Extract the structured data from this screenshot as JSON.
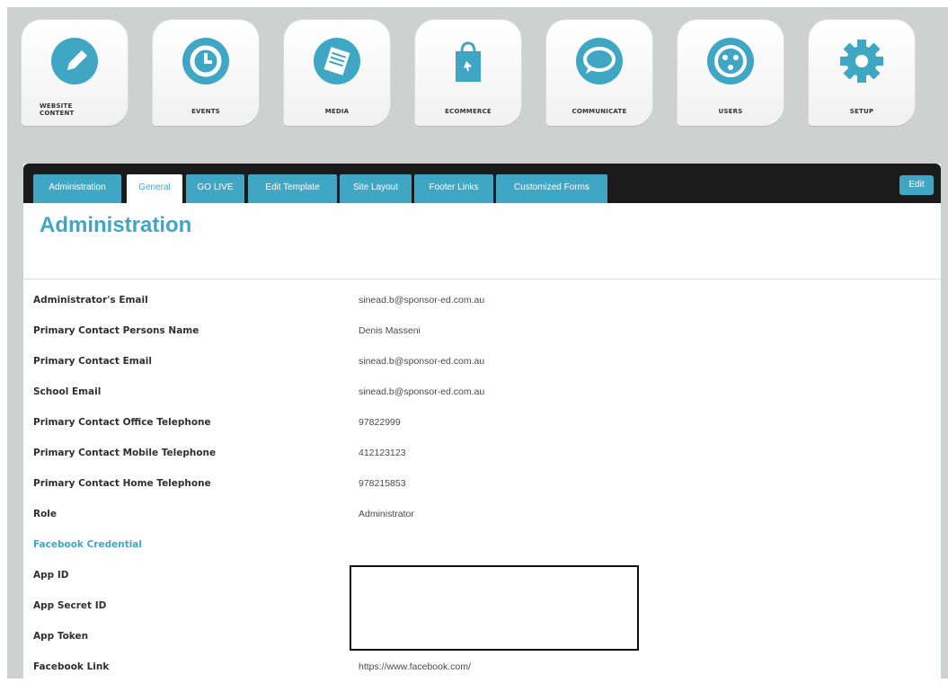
{
  "nav": {
    "tiles": [
      {
        "id": "website-content",
        "label_line1": "WEBSITE",
        "label_line2": "CONTENT",
        "icon": "pencil-icon"
      },
      {
        "id": "events",
        "label": "EVENTS",
        "icon": "clock-icon"
      },
      {
        "id": "media",
        "label": "MEDIA",
        "icon": "document-icon"
      },
      {
        "id": "ecommerce",
        "label": "ECOMMERCE",
        "icon": "shopping-bag-icon"
      },
      {
        "id": "communicate",
        "label": "COMMUNICATE",
        "icon": "speech-bubble-icon"
      },
      {
        "id": "users",
        "label": "USERS",
        "icon": "face-icon"
      },
      {
        "id": "setup",
        "label": "SETUP",
        "icon": "gear-icon"
      }
    ]
  },
  "tabs": [
    "Administration",
    "General",
    "GO LIVE",
    "Edit Template",
    "Site Layout",
    "Footer Links",
    "Customized Forms"
  ],
  "active_tab": "General",
  "edit_label": "Edit",
  "page_title": "Administration",
  "fields": [
    {
      "label": "Administrator's Email",
      "value": "sinead.b@sponsor-ed.com.au"
    },
    {
      "label": "Primary Contact Persons Name",
      "value": "Denis Masseni"
    },
    {
      "label": "Primary Contact Email",
      "value": "sinead.b@sponsor-ed.com.au"
    },
    {
      "label": "School Email",
      "value": "sinead.b@sponsor-ed.com.au"
    },
    {
      "label": "Primary Contact Office Telephone",
      "value": "97822999"
    },
    {
      "label": "Primary Contact Mobile Telephone",
      "value": "412123123"
    },
    {
      "label": "Primary Contact Home Telephone",
      "value": "978215853"
    },
    {
      "label": "Role",
      "value": "Administrator"
    },
    {
      "label": "Facebook Credential",
      "value": ""
    },
    {
      "label": "App ID",
      "value": ""
    },
    {
      "label": "App Secret ID",
      "value": ""
    },
    {
      "label": "App Token",
      "value": ""
    },
    {
      "label": "Facebook Link",
      "value": "https://www.facebook.com/"
    }
  ],
  "colors": {
    "accent": "#3fa7c4",
    "tabbar": "#1b1b1b",
    "background": "#cfd1d0"
  }
}
